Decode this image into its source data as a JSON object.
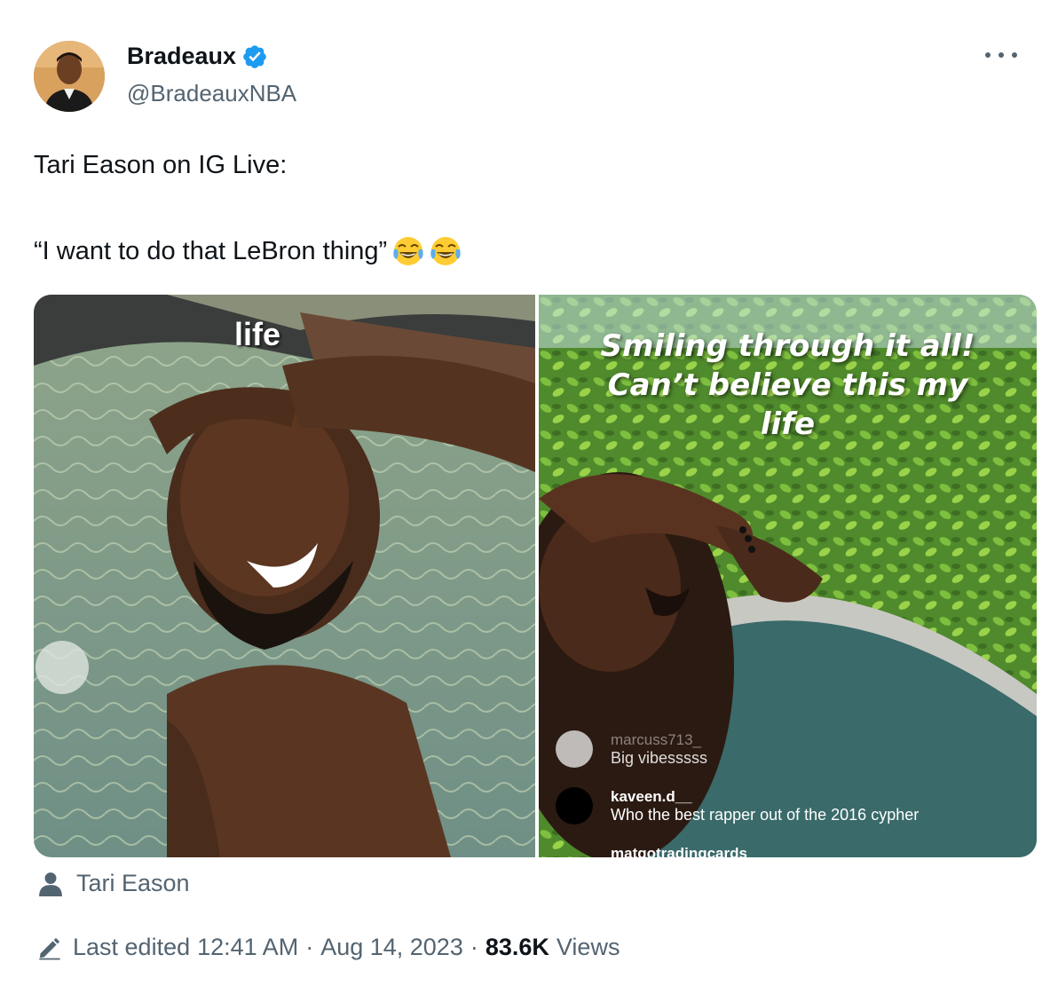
{
  "author": {
    "display_name": "Bradeaux",
    "handle": "@BradeauxNBA",
    "verified": true
  },
  "tweet": {
    "line1": "Tari Eason on IG Live:",
    "line2": "“I want to do that LeBron thing”",
    "emojis": [
      "face-with-tears-of-joy",
      "face-with-tears-of-joy"
    ]
  },
  "media": {
    "left_caption": "life",
    "right_caption_line1": "Smiling through it all!",
    "right_caption_line2": "Can’t believe this my",
    "right_caption_line3": "life",
    "comments": [
      {
        "user": "marcuss713_",
        "message": "Big vibesssss"
      },
      {
        "user": "kaveen.d__",
        "message": "Who the best rapper out of the 2016 cypher"
      },
      {
        "user": "matgotradingcards",
        "message": ""
      }
    ]
  },
  "tagged": {
    "name": "Tari Eason"
  },
  "footer": {
    "edited_label": "Last edited",
    "time": "12:41 AM",
    "date": "Aug 14, 2023",
    "separator": "·",
    "views_count": "83.6K",
    "views_label": "Views"
  },
  "colors": {
    "text_primary": "#0f1419",
    "text_secondary": "#536471",
    "verified_blue": "#1d9bf0"
  }
}
